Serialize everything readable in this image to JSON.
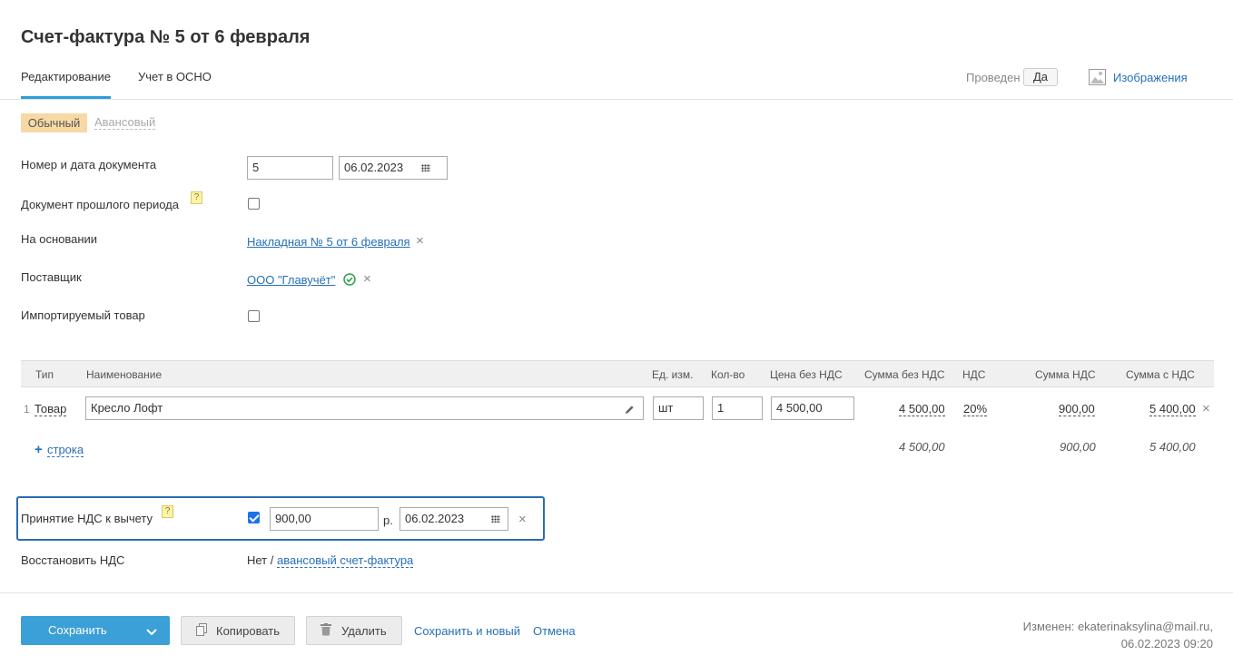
{
  "header": {
    "title": "Счет-фактура № 5 от 6 февраля",
    "tabs": [
      "Редактирование",
      "Учет в ОСНО"
    ],
    "posted_label": "Проведен",
    "posted_value": "Да",
    "images_label": "Изображения"
  },
  "type_switch": {
    "active": "Обычный",
    "inactive": "Авансовый"
  },
  "form": {
    "doc_number_label": "Номер и дата документа",
    "doc_number": "5",
    "doc_date": "06.02.2023",
    "prev_period_label": "Документ прошлого периода",
    "basis_label": "На основании",
    "basis_value": "Накладная № 5 от 6 февраля",
    "supplier_label": "Поставщик",
    "supplier_value": "ООО \"Главучёт\"",
    "imported_label": "Импортируемый товар",
    "help_mark": "?"
  },
  "table": {
    "headers": [
      "Тип",
      "Наименование",
      "Ед. изм.",
      "Кол-во",
      "Цена без НДС",
      "Сумма без НДС",
      "НДС",
      "Сумма НДС",
      "Сумма с НДС"
    ],
    "rows": [
      {
        "index": "1",
        "type": "Товар",
        "name": "Кресло Лофт",
        "unit": "шт",
        "qty": "1",
        "price": "4 500,00",
        "sum_no_vat": "4 500,00",
        "vat_rate": "20%",
        "vat_sum": "900,00",
        "sum_with_vat": "5 400,00"
      }
    ],
    "add_row": "строка",
    "totals": {
      "sum_no_vat": "4 500,00",
      "vat_sum": "900,00",
      "sum_with_vat": "5 400,00"
    }
  },
  "vat_deduction": {
    "label": "Принятие НДС к вычету",
    "checked": true,
    "amount": "900,00",
    "currency": "р.",
    "date": "06.02.2023"
  },
  "restore_vat": {
    "label": "Восстановить НДС",
    "value": "Нет /",
    "link": "авансовый счет-фактура"
  },
  "actions": {
    "save": "Сохранить",
    "copy": "Копировать",
    "delete": "Удалить",
    "save_new": "Сохранить и новый",
    "cancel": "Отмена"
  },
  "footer": {
    "changed_by": "Изменен: ekaterinaksylina@mail.ru,",
    "changed_at": "06.02.2023 09:20"
  },
  "colors": {
    "accent": "#3b9fd8",
    "link": "#2670b8",
    "focus": "#2a6bb5",
    "active_tag": "#f6d9a4"
  }
}
